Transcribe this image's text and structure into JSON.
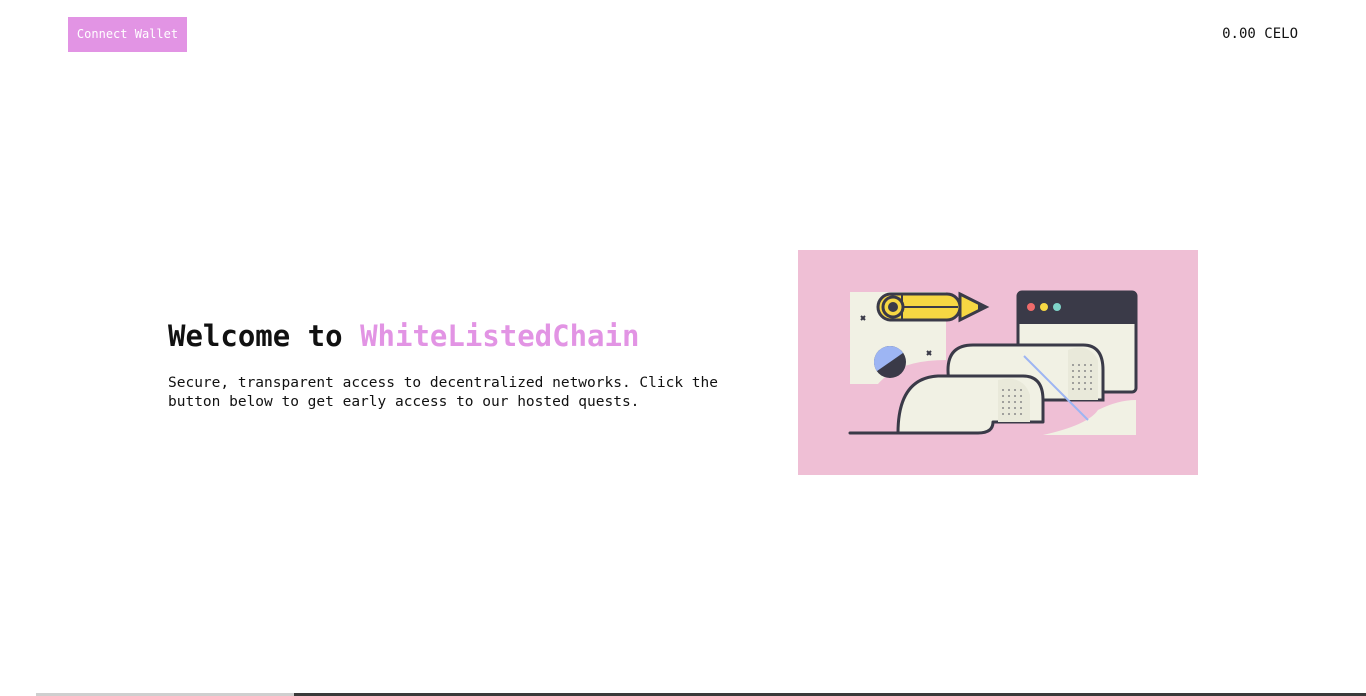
{
  "header": {
    "connect_button_label": "Connect Wallet",
    "balance_amount": "0.00",
    "balance_currency": "CELO"
  },
  "hero": {
    "title_prefix": "Welcome to ",
    "title_brand": "WhiteListedChain",
    "description": "Secure, transparent access to decentralized networks. Click the button below to get early access to our hosted quests."
  },
  "illustration": {
    "icon": "pencil-scroll-browser-illustration"
  },
  "colors": {
    "accent": "#e294e4",
    "illustration_bg": "#efbfd5",
    "text": "#111111"
  }
}
